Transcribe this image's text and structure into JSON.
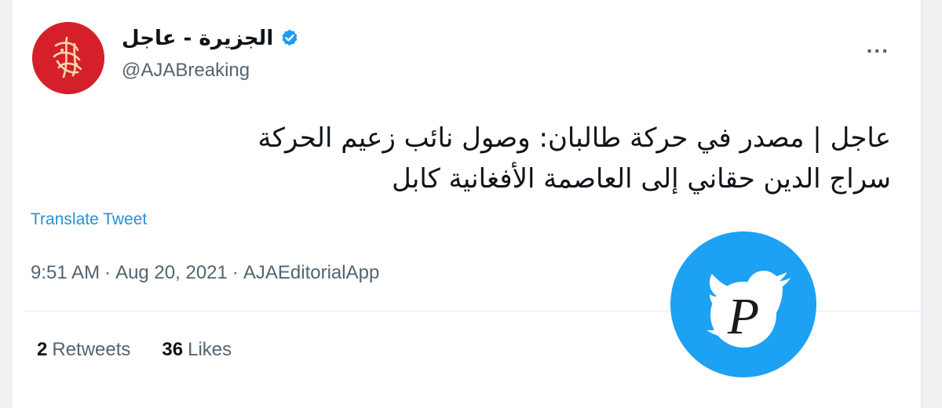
{
  "account": {
    "display_name": "الجزيرة - عاجل",
    "handle": "@AJABreaking",
    "verified_icon": "verified-badge-icon",
    "avatar_icon": "al-jazeera-logo"
  },
  "menu": {
    "more_label": "..."
  },
  "tweet": {
    "text_line1": "عاجل | مصدر في حركة طالبان: وصول نائب زعيم الحركة",
    "text_line2": "سراج الدين حقاني إلى العاصمة الأفغانية كابل",
    "translate_label": "Translate Tweet",
    "time": "9:51 AM",
    "separator": "·",
    "date": "Aug 20, 2021",
    "source": "AJAEditorialApp"
  },
  "stats": {
    "retweets_count": "2",
    "retweets_label": "Retweets",
    "likes_count": "36",
    "likes_label": "Likes"
  },
  "colors": {
    "avatar_bg": "#d5202b",
    "verified": "#1d9bf0",
    "link": "#2a8fd6",
    "watermark_bird": "#1da1f2"
  },
  "watermark": {
    "icon": "twitter-bird-icon",
    "letter": "P"
  }
}
